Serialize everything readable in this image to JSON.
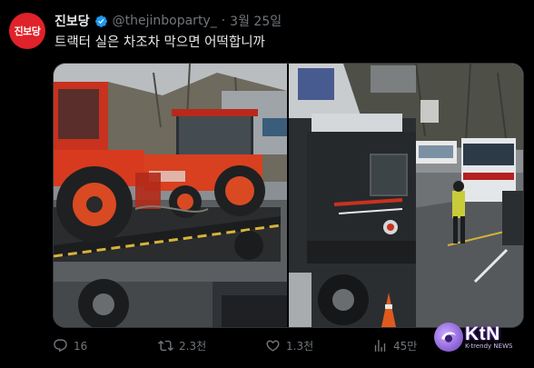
{
  "profile": {
    "avatar_text": "진보당",
    "name": "진보당",
    "handle": "@thejinboparty_",
    "separator": "·",
    "date": "3월 25일"
  },
  "tweet": {
    "text": "트랙터 실은 차조차 막으면 어떡합니까"
  },
  "media": {
    "photos": [
      {
        "subject": "tractor-on-truck"
      },
      {
        "subject": "truck-police-road"
      }
    ]
  },
  "actions": {
    "replies": "16",
    "retweets": "2.3천",
    "likes": "1.3천",
    "views": "45만"
  },
  "watermark": {
    "brand": "KtN",
    "sub": "K-trendy NEWS"
  },
  "colors": {
    "background": "#000000",
    "text_primary": "#e7e9ea",
    "text_secondary": "#71767b",
    "verified": "#1d9bf0",
    "brand_red": "#e0222a"
  }
}
